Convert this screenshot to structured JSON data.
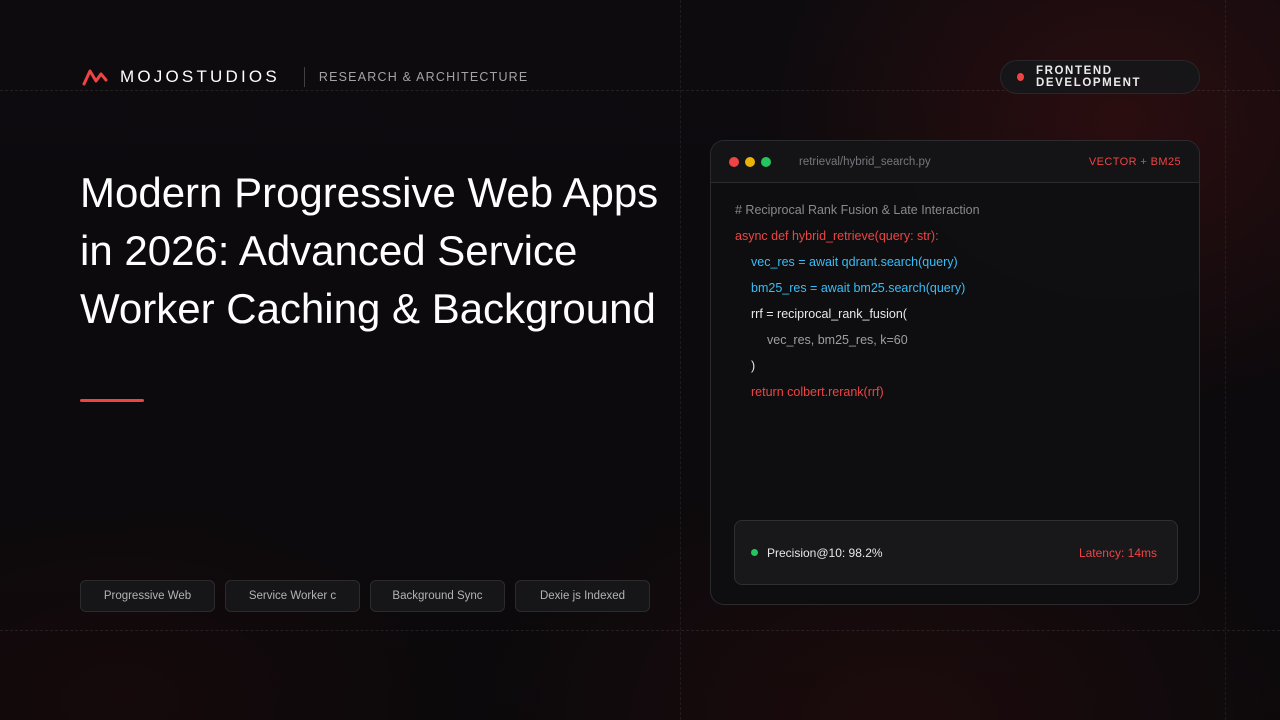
{
  "brand": {
    "name": "MOJOSTUDIOS",
    "section": "RESEARCH & ARCHITECTURE",
    "accent_color": "#ef4444"
  },
  "category_pill": {
    "label": "FRONTEND DEVELOPMENT",
    "dot_color": "#ef4444"
  },
  "title": "Modern Progressive Web Apps in 2026: Advanced Service Worker Caching & Background",
  "tags": [
    "Progressive Web",
    "Service Worker c",
    "Background Sync",
    "Dexie js Indexed"
  ],
  "code_window": {
    "window_dots": [
      "#ef4444",
      "#eab308",
      "#22c55e"
    ],
    "filename": "retrieval/hybrid_search.py",
    "tag": "VECTOR + BM25",
    "lines": [
      {
        "text": "# Reciprocal Rank Fusion & Late Interaction",
        "color": "#8a888d",
        "indent": 0
      },
      {
        "text": "async def hybrid_retrieve(query: str):",
        "color": "#ef4444",
        "indent": 0
      },
      {
        "text": "vec_res = await qdrant.search(query)",
        "color": "#38bdf8",
        "indent": 1
      },
      {
        "text": "bm25_res = await bm25.search(query)",
        "color": "#38bdf8",
        "indent": 1
      },
      {
        "text": "rrf = reciprocal_rank_fusion(",
        "color": "#e8e8e8",
        "indent": 1
      },
      {
        "text": "vec_res, bm25_res, k=60",
        "color": "#a09ea3",
        "indent": 2
      },
      {
        "text": ")",
        "color": "#e8e8e8",
        "indent": 1
      },
      {
        "text": "return colbert.rerank(rrf)",
        "color": "#ef4444",
        "indent": 1
      }
    ],
    "status": {
      "metric": "Precision@10: 98.2%",
      "metric_dot_color": "#22c55e",
      "latency": "Latency: 14ms",
      "latency_color": "#ef4444"
    }
  }
}
